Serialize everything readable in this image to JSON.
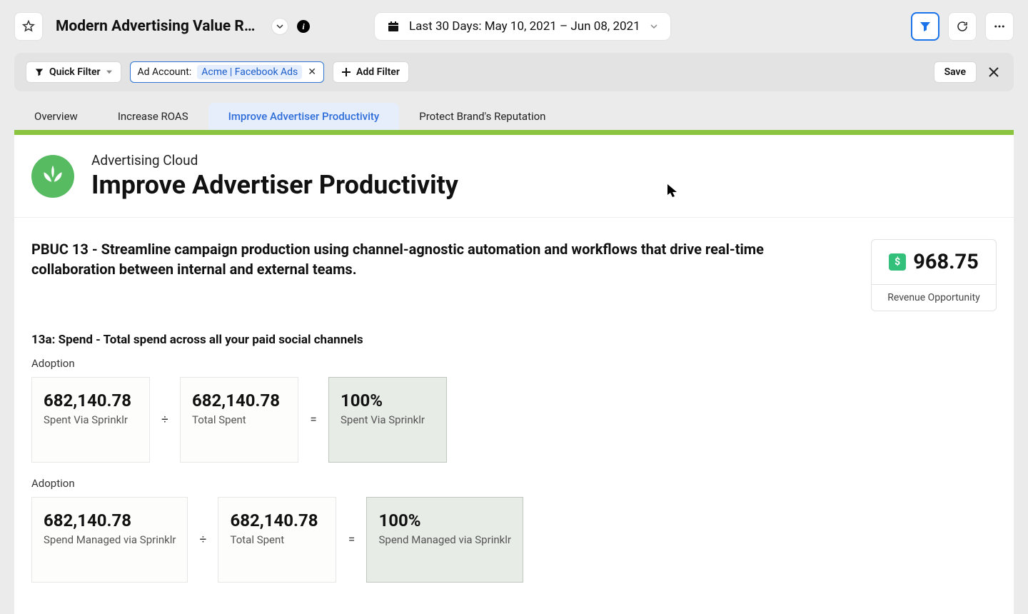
{
  "header": {
    "title": "Modern Advertising Value Realizati...",
    "date_range": "Last 30 Days: May 10, 2021 – Jun 08, 2021"
  },
  "filterbar": {
    "quick_filter": "Quick Filter",
    "chip_label": "Ad Account:",
    "chip_value": "Acme | Facebook Ads",
    "add_filter": "Add Filter",
    "save": "Save"
  },
  "tabs": [
    "Overview",
    "Increase ROAS",
    "Improve Advertiser Productivity",
    "Protect Brand's Reputation"
  ],
  "page": {
    "subtitle": "Advertising Cloud",
    "heading": "Improve Advertiser Productivity",
    "description": "PBUC 13 - Streamline campaign production using channel-agnostic automation and workflows that drive real-time collaboration between internal and external teams.",
    "revenue_value": "968.75",
    "revenue_label": "Revenue Opportunity"
  },
  "metrics": {
    "title": "13a: Spend - Total spend across all your paid social channels",
    "blocks": [
      {
        "sub": "Adoption",
        "a_val": "682,140.78",
        "a_label": "Spent Via Sprinklr",
        "b_val": "682,140.78",
        "b_label": "Total Spent",
        "r_val": "100%",
        "r_label": "Spent Via Sprinklr"
      },
      {
        "sub": "Adoption",
        "a_val": "682,140.78",
        "a_label": "Spend Managed via Sprinklr",
        "b_val": "682,140.78",
        "b_label": "Total Spent",
        "r_val": "100%",
        "r_label": "Spend Managed via Sprinklr"
      }
    ]
  },
  "ops": {
    "divide": "÷",
    "equals": "="
  },
  "icons": {
    "dollar": "$",
    "info": "i"
  }
}
